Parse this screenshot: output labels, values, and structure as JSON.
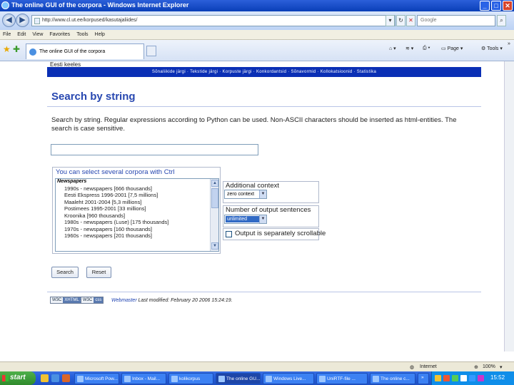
{
  "window": {
    "title": "The online GUI of the corpora - Windows Internet Explorer"
  },
  "address": {
    "url": "http://www.cl.ut.ee/korpused/kasutajaliides/",
    "search_placeholder": "Google"
  },
  "menu": [
    "File",
    "Edit",
    "View",
    "Favorites",
    "Tools",
    "Help"
  ],
  "tab": {
    "title": "The online GUI of the corpora"
  },
  "commands": {
    "page": "Page",
    "tools": "Tools"
  },
  "page": {
    "est_link": "Eesti keeles",
    "nav_band": "Sõnaliikide järgi · Tekstide järgi · Korpuste järgi · Konkordantsid · Sõnavormid · Kollokatsioonid · Statistika",
    "title": "Search by string",
    "intro": "Search by string. Regular expressions according to Python can be used. Non-ASCII characters should be inserted as html-entities. The search is case sensitive.",
    "corpus_legend": "You can select several corpora with Ctrl",
    "corpus_group": "Newspapers",
    "corpora": [
      "1990s - newspapers [666 thousands]",
      "Eesti Ekspress 1996-2001 [7,5 millions]",
      "Maaleht 2001-2004 [5,3 millions]",
      "Postimees 1995-2001 [33 millions]",
      "Kroonika [960 thousands]",
      "1980s - newspapers (Luse) [175 thousands]",
      "1970s - newspapers [160 thousands]",
      "1960s - newspapers [201 thousands]"
    ],
    "context_legend": "Additional context",
    "context_value": "zero context",
    "output_legend": "Number of output sentences",
    "output_value": "unlimited",
    "scroll_label": "Output is separately scrollable",
    "search_button": "Search",
    "reset_button": "Reset",
    "w3c_html_a": "W3C",
    "w3c_html_b": "XHTML 1.0",
    "w3c_css_a": "W3C",
    "w3c_css_b": "css",
    "footer_webmaster": "Webmaster",
    "footer_modified": "Last modified: February 20 2006 15:24:19."
  },
  "status": {
    "zone": "Internet",
    "zoom": "100%"
  },
  "taskbar": {
    "start": "start",
    "tasks": [
      "Microsoft Pow...",
      "Inbox - Mail...",
      "kolikorpus",
      "The online GU...",
      "Windows Live...",
      "UniRTF-file ...",
      "The online c..."
    ],
    "clock": "15:52"
  }
}
